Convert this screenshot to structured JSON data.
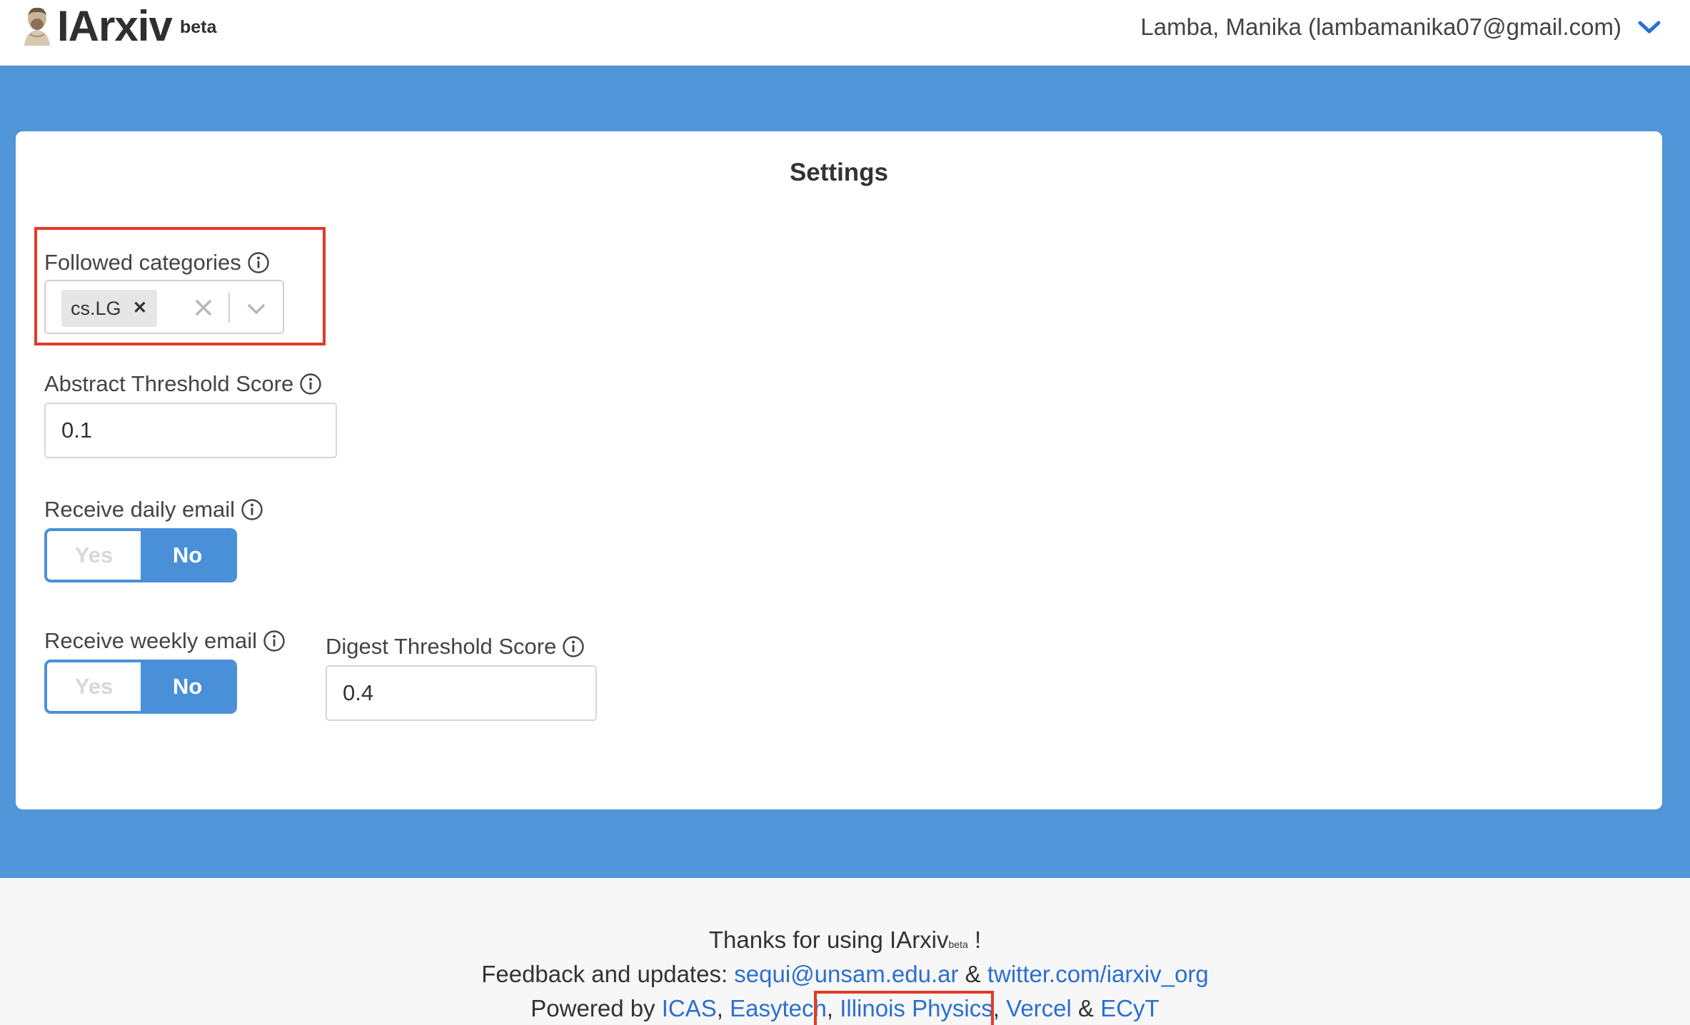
{
  "header": {
    "logo_text": "IArxiv",
    "logo_badge": "beta",
    "user_label": "Lamba, Manika (lambamanika07@gmail.com)"
  },
  "settings": {
    "title": "Settings",
    "followed_categories": {
      "label": "Followed categories",
      "selected": [
        "cs.LG"
      ]
    },
    "abstract_threshold": {
      "label": "Abstract Threshold Score",
      "value": "0.1"
    },
    "daily_email": {
      "label": "Receive daily email",
      "yes_label": "Yes",
      "no_label": "No",
      "selected": "No"
    },
    "weekly_email": {
      "label": "Receive weekly email",
      "yes_label": "Yes",
      "no_label": "No",
      "selected": "No"
    },
    "digest_threshold": {
      "label": "Digest Threshold Score",
      "value": "0.4"
    }
  },
  "footer": {
    "thanks_prefix": "Thanks for using IArxiv",
    "thanks_badge": "beta",
    "thanks_suffix": "!",
    "feedback_prefix": "Feedback and updates:",
    "feedback_email": "sequi@unsam.edu.ar",
    "feedback_amp": "&",
    "feedback_twitter": "twitter.com/iarxiv_org",
    "powered_prefix": "Powered by",
    "powered_links": [
      "ICAS",
      "Easytech",
      "Illinois Physics",
      "Vercel",
      "ECyT"
    ],
    "powered_sep_1": ",",
    "powered_sep_2": ",",
    "powered_sep_3": ",",
    "powered_amp": "&"
  },
  "colors": {
    "brand_blue": "#5096d8",
    "toggle_blue": "#4a90d9",
    "link_blue": "#2b6fd1",
    "highlight_red": "#e03b2b"
  }
}
